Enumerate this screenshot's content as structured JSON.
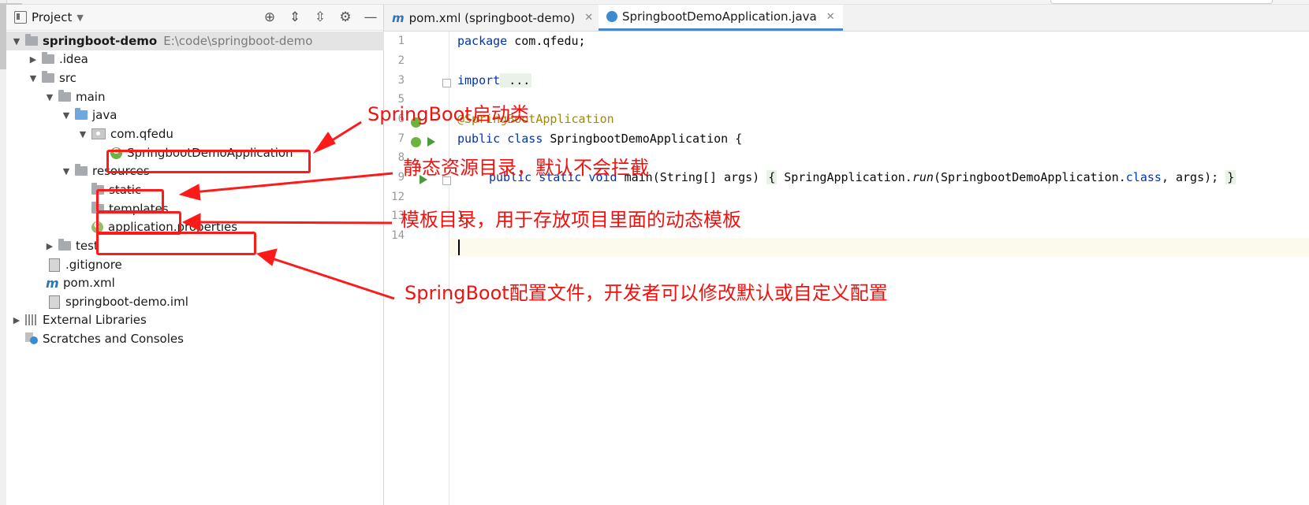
{
  "project_pane": {
    "title": "Project",
    "tools": [
      "target-icon",
      "expand-icon",
      "collapse-icon",
      "gear-icon",
      "minimize-icon"
    ],
    "tree": [
      {
        "label": "springboot-demo",
        "path": "E:\\code\\springboot-demo"
      },
      {
        "label": ".idea"
      },
      {
        "label": "src"
      },
      {
        "label": "main"
      },
      {
        "label": "java"
      },
      {
        "label": "com.qfedu"
      },
      {
        "label": "SpringbootDemoApplication"
      },
      {
        "label": "resources"
      },
      {
        "label": "static"
      },
      {
        "label": "templates"
      },
      {
        "label": "application.properties"
      },
      {
        "label": "test"
      },
      {
        "label": ".gitignore"
      },
      {
        "label": "pom.xml"
      },
      {
        "label": "springboot-demo.iml"
      },
      {
        "label": "External Libraries"
      },
      {
        "label": "Scratches and Consoles"
      }
    ]
  },
  "editor": {
    "tabs": [
      {
        "label": "pom.xml (springboot-demo)",
        "icon_letter": "m"
      },
      {
        "label": "SpringbootDemoApplication.java",
        "active": true
      }
    ],
    "line_numbers": [
      "1",
      "2",
      "3",
      "5",
      "6",
      "7",
      "8",
      "9",
      "12",
      "13",
      "14"
    ],
    "code": {
      "l1_kw": "package",
      "l1_rest": " com.qfedu;",
      "l3_kw": "import",
      "l3_rest": " ...",
      "l6": "@SpringBootApplication",
      "l7_kw": "public class",
      "l7_rest": " SpringbootDemoApplication {",
      "l9_kw": "public static void",
      "l9_a": " main(String[] args) ",
      "l9_b": "{",
      "l9_c": " SpringApplication.",
      "l9_run": "run",
      "l9_d": "(SpringbootDemoApplication.",
      "l9_cls": "class",
      "l9_e": ", args); ",
      "l9_f": "}",
      "l13": "}"
    }
  },
  "annotations": [
    {
      "text": "SpringBoot启动类"
    },
    {
      "text": "静态资源目录，默认不会拦截"
    },
    {
      "text": "模板目录，用于存放项目里面的动态模板"
    },
    {
      "text": "SpringBoot配置文件，开发者可以修改默认或自定义配置"
    }
  ],
  "colors": {
    "annotation_red": "#ff1a1a",
    "keyword": "#0033b3",
    "annotation_code": "#9e880d"
  }
}
